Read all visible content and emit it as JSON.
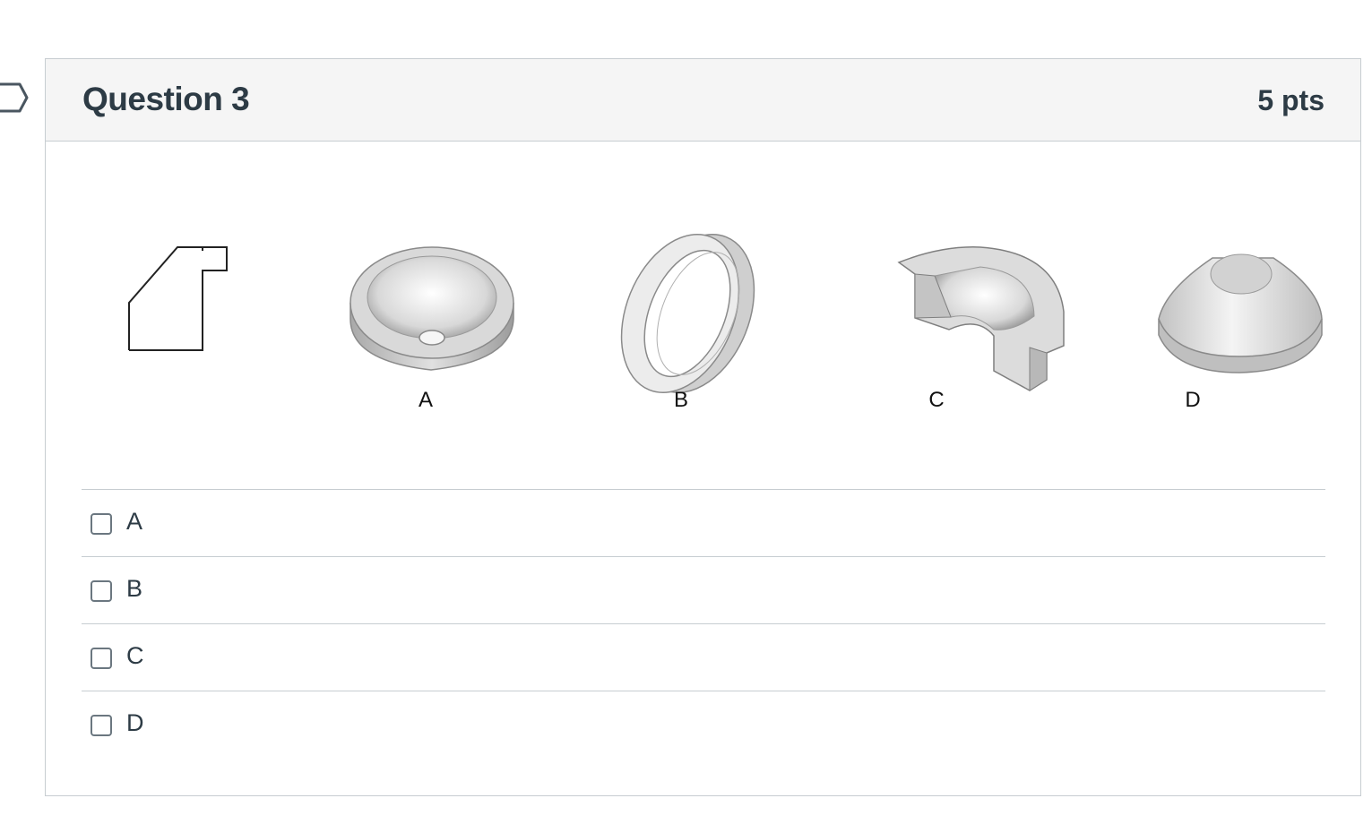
{
  "question": {
    "title": "Question 3",
    "points": "5 pts"
  },
  "figure": {
    "labels": [
      "A",
      "B",
      "C",
      "D"
    ]
  },
  "answers": [
    {
      "label": "A",
      "checked": false
    },
    {
      "label": "B",
      "checked": false
    },
    {
      "label": "C",
      "checked": false
    },
    {
      "label": "D",
      "checked": false
    }
  ],
  "icons": {
    "flag": "flag-outline-icon"
  }
}
